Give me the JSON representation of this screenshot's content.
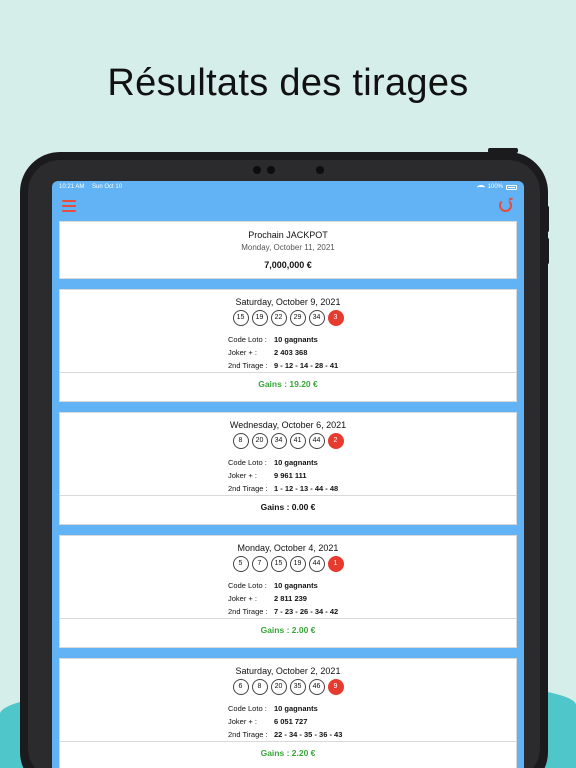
{
  "headline": "Résultats des tirages",
  "status": {
    "time": "10:21 AM",
    "date": "Sun Oct 10",
    "battery": "100%"
  },
  "jackpot": {
    "title": "Prochain JACKPOT",
    "date": "Monday, October 11, 2021",
    "amount": "7,000,000 €"
  },
  "labels": {
    "code_loto": "Code Loto :",
    "joker": "Joker + :",
    "second": "2nd Tirage :"
  },
  "draws": [
    {
      "date": "Saturday, October 9, 2021",
      "numbers": [
        "15",
        "19",
        "22",
        "29",
        "34"
      ],
      "lucky": "3",
      "code_loto": "10 gagnants",
      "joker": "2 403 368",
      "second": "9 - 12 - 14 - 28 - 41",
      "gains": "Gains : 19.20 €"
    },
    {
      "date": "Wednesday, October 6, 2021",
      "numbers": [
        "8",
        "20",
        "34",
        "41",
        "44"
      ],
      "lucky": "2",
      "code_loto": "10 gagnants",
      "joker": "9 961 111",
      "second": "1 - 12 - 13 - 44 - 48",
      "gains": "Gains : 0.00 €"
    },
    {
      "date": "Monday, October 4, 2021",
      "numbers": [
        "5",
        "7",
        "15",
        "19",
        "44"
      ],
      "lucky": "1",
      "code_loto": "10 gagnants",
      "joker": "2 811 239",
      "second": "7 - 23 - 26 - 34 - 42",
      "gains": "Gains : 2.00 €"
    },
    {
      "date": "Saturday, October 2, 2021",
      "numbers": [
        "6",
        "8",
        "20",
        "35",
        "46"
      ],
      "lucky": "9",
      "code_loto": "10 gagnants",
      "joker": "6 051 727",
      "second": "22 - 34 - 35 - 36 - 43",
      "gains": "Gains : 2.20 €"
    }
  ],
  "colors": {
    "accent": "#e74c3c",
    "win": "#3aa53a",
    "screen_bg": "#61b3f5"
  }
}
